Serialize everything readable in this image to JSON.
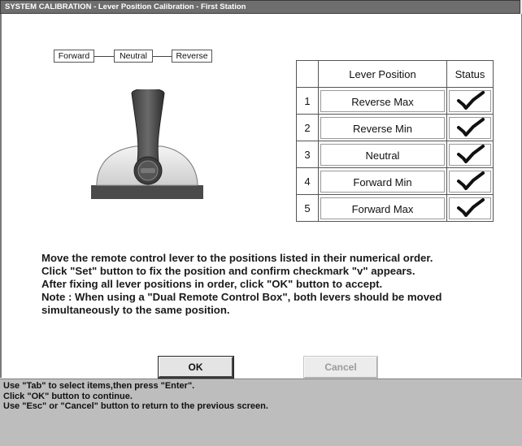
{
  "window": {
    "title": "SYSTEM CALIBRATION  - Lever Position Calibration - First Station"
  },
  "diagram": {
    "forward": "Forward",
    "neutral": "Neutral",
    "reverse": "Reverse"
  },
  "table": {
    "header_position": "Lever Position",
    "header_status": "Status",
    "rows": [
      {
        "num": "1",
        "position": "Reverse Max",
        "status_icon": "checkmark-icon"
      },
      {
        "num": "2",
        "position": "Reverse Min",
        "status_icon": "checkmark-icon"
      },
      {
        "num": "3",
        "position": "Neutral",
        "status_icon": "checkmark-icon"
      },
      {
        "num": "4",
        "position": "Forward Min",
        "status_icon": "checkmark-icon"
      },
      {
        "num": "5",
        "position": "Forward Max",
        "status_icon": "checkmark-icon"
      }
    ]
  },
  "instructions": {
    "line1": "Move the remote control lever to the positions listed in their numerical order.",
    "line2": "Click \"Set\" button to fix the position and confirm checkmark \"v\" appears.",
    "line3": "After fixing all lever positions in order, click \"OK\" button to accept.",
    "line4": "Note : When using a \"Dual Remote Control Box\", both levers should be moved",
    "line5": "simultaneously to the same position."
  },
  "buttons": {
    "ok": "OK",
    "cancel": "Cancel"
  },
  "help": {
    "line1": "Use \"Tab\" to select items,then press \"Enter\".",
    "line2": "Click \"OK\" button to continue.",
    "line3": "Use \"Esc\" or \"Cancel\" button to return to the previous screen."
  }
}
